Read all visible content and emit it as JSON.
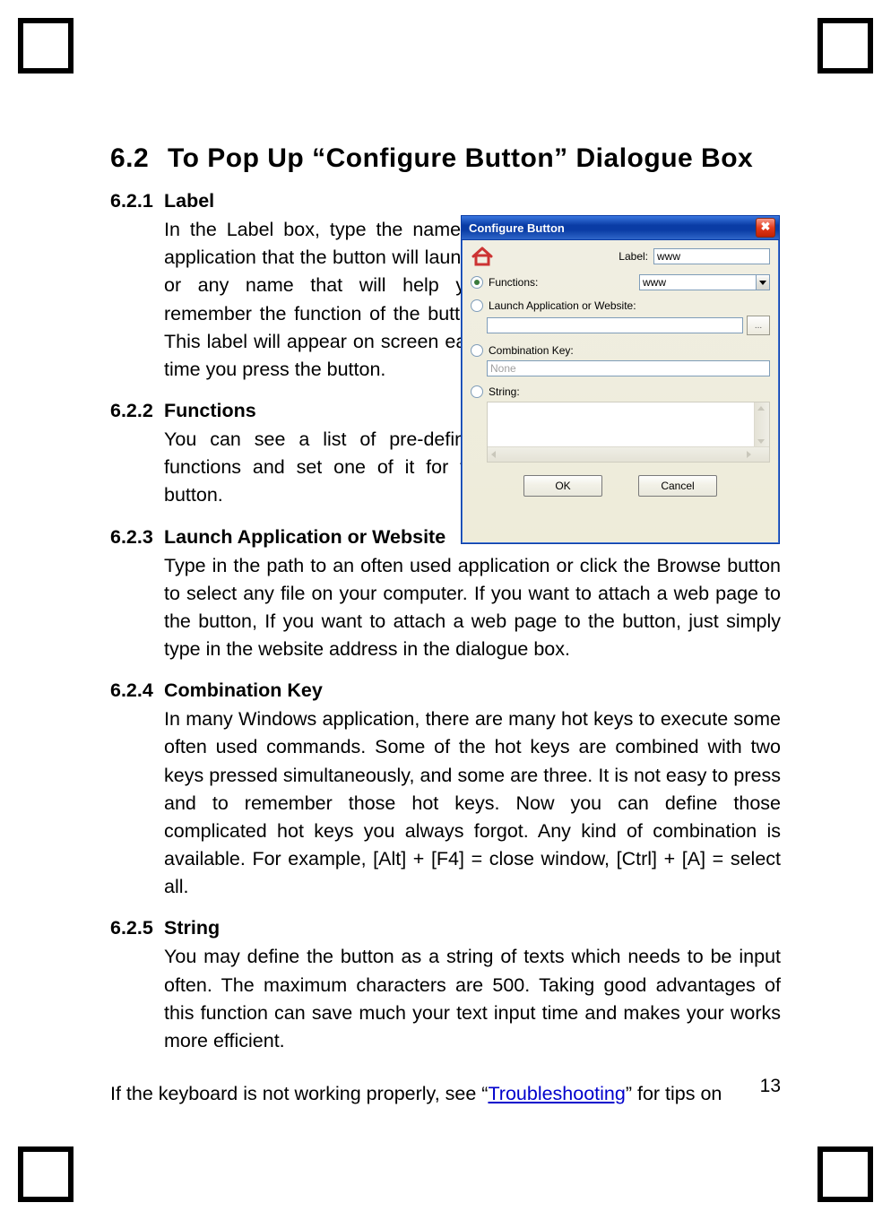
{
  "page_number": "13",
  "heading": {
    "num": "6.2",
    "title": "To Pop Up “Configure Button” Dialogue Box"
  },
  "s1": {
    "num": "6.2.1",
    "title": "Label",
    "body": "In the Label box, type the name of application that the button will launch, or any name that will help you remember the function of the button. This label will appear on screen each time you press the button."
  },
  "s2": {
    "num": "6.2.2",
    "title": "Functions",
    "body": "You can see a list of pre-defined functions and set one of it for the button."
  },
  "s3": {
    "num": "6.2.3",
    "title": "Launch Application or Website",
    "body": "Type in the path to an often used application or click the Browse button to select any file on your computer. If you want to attach a web page to the button, If you want to attach a web page to the button, just simply type in the website address in the dialogue box."
  },
  "s4": {
    "num": "6.2.4",
    "title": "Combination Key",
    "body": "In many Windows application, there are many hot keys to execute some often used commands. Some of the hot keys are combined with two keys pressed simultaneously, and some are three. It is not easy to press and to remember those hot keys. Now you can define those complicated hot keys you always forgot. Any kind of combination is available. For example, [Alt] + [F4] = close window, [Ctrl] + [A] = select all."
  },
  "s5": {
    "num": "6.2.5",
    "title": "String",
    "body": "You may define the button as a string of texts which needs to be input often. The maximum characters are 500. Taking good advantages of this function can save much your text input time and makes your works more efficient."
  },
  "footer": {
    "pre": "If the keyboard is not working properly, see “",
    "link": "Troubleshooting",
    "post": "” for tips on"
  },
  "dialog": {
    "title": "Configure Button",
    "close_glyph": "✖",
    "label_caption": "Label:",
    "label_value": "www",
    "opt_functions": "Functions:",
    "functions_value": "www",
    "opt_launch": "Launch Application or Website:",
    "launch_value": "",
    "browse_glyph": "...",
    "opt_combokey": "Combination Key:",
    "combokey_value": "None",
    "opt_string": "String:",
    "string_value": "",
    "ok": "OK",
    "cancel": "Cancel"
  }
}
